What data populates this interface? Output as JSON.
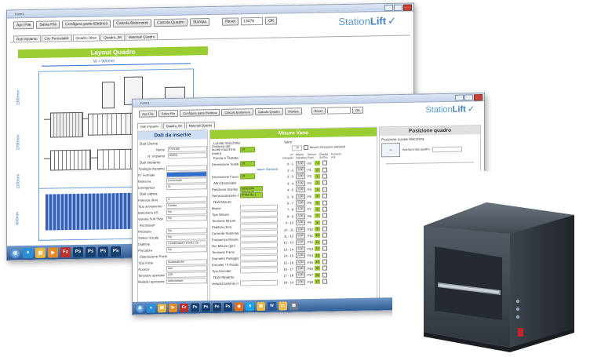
{
  "back_window": {
    "toolbar": {
      "buttons": [
        "Apri File",
        "Salva File",
        "Configura parte Elettrica",
        "Calcola Bottoniere",
        "Calcola Quadro",
        "Stampa",
        "Reset"
      ],
      "field_value": "13076",
      "ok_label": "OK"
    },
    "tabs": [
      "Dati Impianto",
      "Circ Pericolabili",
      "Quadro Obsv",
      "Quadro_IM",
      "Materiali Quadro"
    ],
    "logo": {
      "part1": "Station",
      "part2": "Lift"
    },
    "layout_title": "Layout Quadro",
    "width_label": "W = 900mm",
    "height_labels": [
      "1300mm",
      "2700mm",
      "1100mm",
      "800mm"
    ],
    "taskbar_icons": [
      "windows-orb",
      "ie",
      "explorer",
      "media",
      "filezilla",
      "photoshop",
      "photoshop",
      "photoshop",
      "photoshop"
    ]
  },
  "front_window": {
    "toolbar": {
      "buttons": [
        "Apri File",
        "Salva File",
        "Configura parte Elettrica",
        "Calcola Bottoniere",
        "Calcola Quadro",
        "Stampa",
        "Reset"
      ],
      "ok_label": "OK"
    },
    "tabs": [
      "Dati Impianto",
      "Quadro_IM",
      "Materiali Quadro"
    ],
    "logo": {
      "part1": "Station",
      "part2": "Lift"
    },
    "left_panel": {
      "title": "Dati da inserire",
      "section_client": "Dati Cliente",
      "client_rows": [
        {
          "label": "Nome",
          "value": "ROLAB"
        },
        {
          "label": "N° impianto",
          "value": "00001"
        }
      ],
      "section_impianto": "Dati Impianto",
      "impianto_rows": [
        {
          "label": "Tipologia impianto",
          "value": ""
        },
        {
          "label": "N° Fermate",
          "value": ""
        },
        {
          "label": "Manovra",
          "value": "Universale"
        },
        {
          "label": "Emergenza",
          "value": "Si"
        }
      ],
      "section_cabina": "Dati cabina",
      "cabina_rows": [
        {
          "label": "Potenza (Kw)",
          "value": "4"
        },
        {
          "label": "Tipo avviamento",
          "value": "Diretto"
        },
        {
          "label": "Bottoniera AS",
          "value": "No"
        },
        {
          "label": "Valvola Soft Stop",
          "value": "No"
        }
      ],
      "section_accessori": "Accessori",
      "accessori_rows": [
        {
          "label": "Pesatura",
          "value": "No"
        },
        {
          "label": "Sintesi Vocale",
          "value": "No"
        },
        {
          "label": "Dialtime",
          "value": "Combinatore DS4/1-20"
        },
        {
          "label": "Precatore",
          "value": "No"
        }
      ],
      "section_opzioni": "Operazione Porte",
      "opzioni_rows": [
        {
          "label": "Tipo Porte",
          "value": "Automatiche"
        },
        {
          "label": "Accessi",
          "value": "uno"
        },
        {
          "label": "Tensione operatore",
          "value": "220"
        },
        {
          "label": "Modello operatore",
          "value": "selezionare"
        }
      ]
    },
    "middle_panel": {
      "title": "Misure Vano",
      "section1": "Locale macchina",
      "m1_rows": [
        {
          "label": "Distanza dal locale macchina (metri)",
          "value": "10"
        }
      ],
      "section2": "Fossa e Testata",
      "m2_rows": [
        {
          "label": "Dimensione Testata (m)",
          "value": "10"
        },
        {
          "label": "Dimensione Fossa (m)",
          "value": "10"
        }
      ],
      "valore_standard": "Valore Standard",
      "section3": "Altri Dispositivi",
      "m3_rows": [
        {
          "label": "Posizione Display",
          "value": "posizione principale"
        },
        {
          "label": "Semicircolazione Piani",
          "value": "Primo da 1"
        }
      ],
      "section4": "Dati Misure",
      "m4_rows": [
        "Marce",
        "Tipo Misura",
        "Tensione Misure",
        "Platifoto (Km)",
        "Corrente Nominale",
        "Frequenza Misure (Hz)",
        "Giri Misure (giri)",
        "Tensione Freno",
        "Diametro Puleggia (mm)",
        "Encoder / Il fissato",
        "Tipo Encoder"
      ],
      "section5": "Dati Impianto",
      "m5_row": "Velocità sistema (m/s)",
      "vano_label": "Vano",
      "vano_value": "10",
      "standard_label": "Misure interpiano standard",
      "col_headers": [
        "N° Interpiani",
        "Misure Interpiani",
        "Denom. Piani",
        "Display Su/Giu",
        "Accesso A B"
      ],
      "vano_rows": [
        {
          "n": "0 - 1",
          "m": "3,30",
          "p": "P0",
          "d": "-1"
        },
        {
          "n": "1 - 2",
          "m": "3,30",
          "p": "P1",
          "d": "0"
        },
        {
          "n": "2 - 3",
          "m": "3,30",
          "p": "P2",
          "d": "1"
        },
        {
          "n": "3 - 4",
          "m": "3,30",
          "p": "P3",
          "d": "2"
        },
        {
          "n": "4 - 5",
          "m": "3,30",
          "p": "P4",
          "d": "3"
        },
        {
          "n": "5 - 6",
          "m": "3,30",
          "p": "P5",
          "d": "4"
        },
        {
          "n": "6 - 7",
          "m": "3,30",
          "p": "P6",
          "d": "5"
        },
        {
          "n": "7 - 8",
          "m": "3,30",
          "p": "P7",
          "d": "6"
        },
        {
          "n": "8 - 9",
          "m": "3,30",
          "p": "P8",
          "d": "7"
        },
        {
          "n": "9 - 10",
          "m": "3,30",
          "p": "P9",
          "d": "8"
        },
        {
          "n": "10 - 11",
          "m": "3,30",
          "p": "P10",
          "d": "9"
        },
        {
          "n": "11 - 12",
          "m": "3,30",
          "p": "P11",
          "d": "10"
        },
        {
          "n": "12 - 13",
          "m": "3,30",
          "p": "P12",
          "d": "11"
        },
        {
          "n": "13 - 14",
          "m": "3,30",
          "p": "P13",
          "d": "12"
        },
        {
          "n": "14 - 15",
          "m": "3,30",
          "p": "P14",
          "d": "13"
        },
        {
          "n": "15 - 16",
          "m": "3,30",
          "p": "P15",
          "d": "14"
        },
        {
          "n": "16 - 17",
          "m": "3,30",
          "p": "P16",
          "d": "15"
        },
        {
          "n": "17 - 18",
          "m": "3,30",
          "p": "P17",
          "d": "16"
        },
        {
          "n": "18 - 19",
          "m": "3,30",
          "p": "P18",
          "d": "17"
        }
      ]
    },
    "right_panel": {
      "title": "Posizione quadro",
      "subtitle": "Posizione Locale Macchina",
      "apertura_label": "Apertura lato quadro"
    },
    "taskbar_icons": [
      "windows-orb",
      "ie",
      "explorer",
      "media",
      "filezilla",
      "photoshop",
      "photoshop",
      "photoshop",
      "photoshop",
      "firefox",
      "skype",
      "explorer",
      "word",
      "folder",
      "app"
    ]
  },
  "colors": {
    "accent_green": "#9acd32",
    "logo_blue": "#3c7ec1",
    "header_blue": "#cfe0f4"
  }
}
